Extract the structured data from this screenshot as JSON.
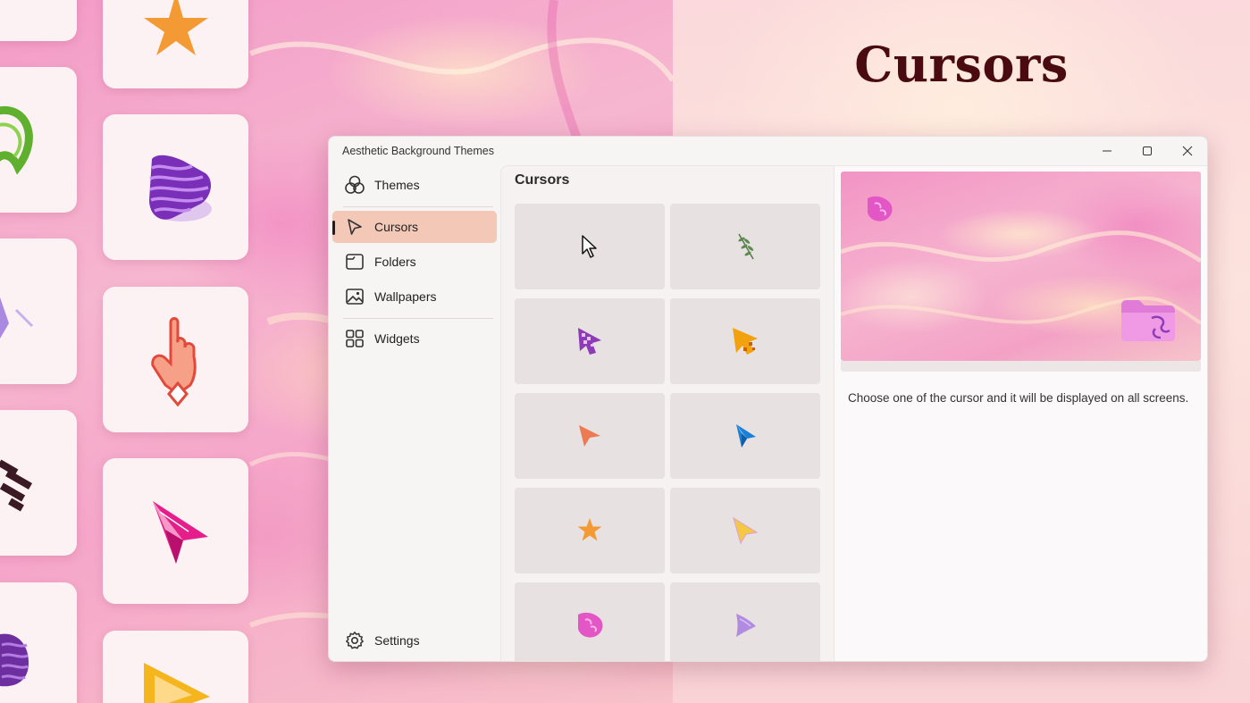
{
  "hero": {
    "title": "Cursors"
  },
  "window": {
    "title": "Aesthetic Background Themes",
    "controls": [
      "minimize-icon",
      "maximize-icon",
      "close-icon"
    ]
  },
  "sidebar": {
    "items": [
      {
        "label": "Themes",
        "icon": "themes-icon",
        "selected": false
      },
      {
        "label": "Cursors",
        "icon": "cursor-icon",
        "selected": true
      },
      {
        "label": "Folders",
        "icon": "folder-icon",
        "selected": false
      },
      {
        "label": "Wallpapers",
        "icon": "image-icon",
        "selected": false
      },
      {
        "label": "Widgets",
        "icon": "widgets-icon",
        "selected": false
      }
    ],
    "settings": {
      "label": "Settings",
      "icon": "gear-icon"
    }
  },
  "content": {
    "title": "Cursors",
    "cursors": [
      {
        "name": "classic-arrow-cursor",
        "color": "#ffffff"
      },
      {
        "name": "leaf-sprig-cursor",
        "color": "#4f7a45"
      },
      {
        "name": "purple-pixel-cursor",
        "color": "#8e3bb7"
      },
      {
        "name": "orange-pixel-cursor",
        "color": "#f2a10f"
      },
      {
        "name": "orange-arrow-cursor",
        "color": "#ec7a52"
      },
      {
        "name": "blue-geometric-cursor",
        "color": "#1e7fd6"
      },
      {
        "name": "orange-star-cursor",
        "color": "#f49a34"
      },
      {
        "name": "yellow-arrow-cursor",
        "color": "#f5c842"
      },
      {
        "name": "pink-blob-cursor",
        "color": "#e256c6"
      },
      {
        "name": "lavender-arrow-cursor",
        "color": "#b08be0"
      }
    ]
  },
  "preview": {
    "description": "Choose one of the cursor and it will be displayed on all screens."
  },
  "colors": {
    "accent": "#f3c8b6",
    "hero_title": "#4a0b10"
  }
}
